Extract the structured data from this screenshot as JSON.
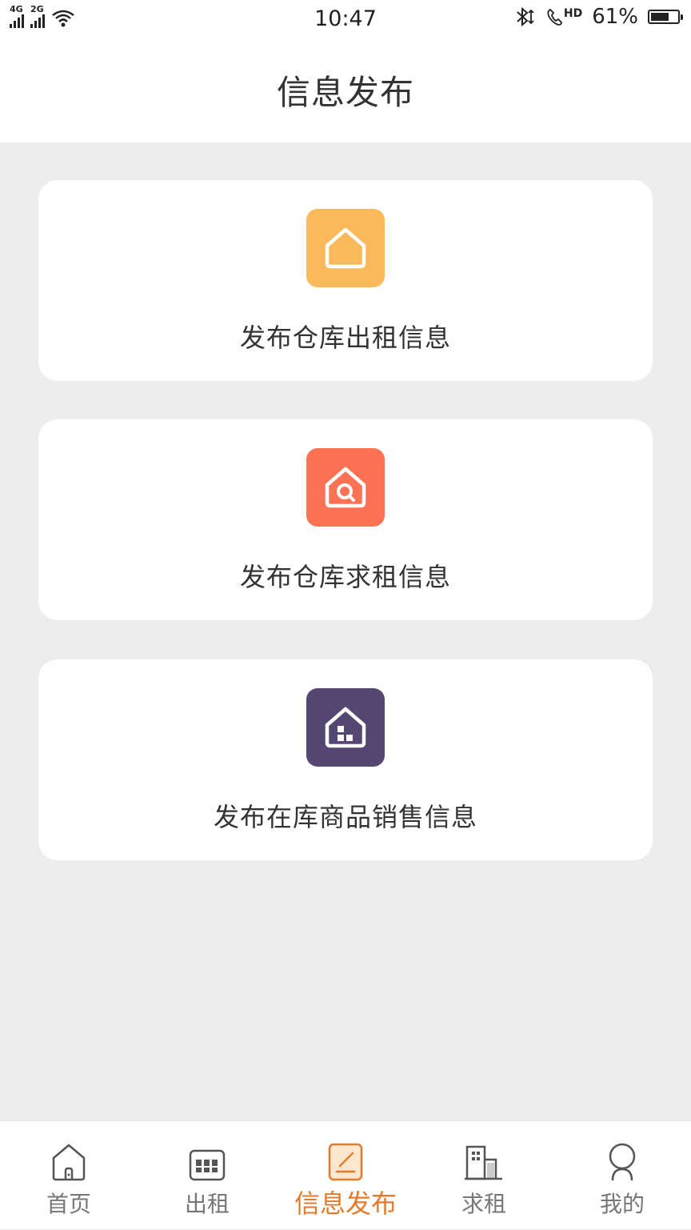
{
  "status_bar": {
    "network_1": "4G",
    "network_2": "2G",
    "time": "10:47",
    "hd": "HD",
    "battery": "61%"
  },
  "header": {
    "title": "信息发布"
  },
  "cards": [
    {
      "label": "发布仓库出租信息",
      "icon": "house-icon",
      "color": "#fcb95b"
    },
    {
      "label": "发布仓库求租信息",
      "icon": "house-search-icon",
      "color": "#fd7255"
    },
    {
      "label": "发布在库商品销售信息",
      "icon": "house-goods-icon",
      "color": "#544772"
    }
  ],
  "tabbar": {
    "items": [
      {
        "label": "首页",
        "icon": "home-icon"
      },
      {
        "label": "出租",
        "icon": "warehouse-icon"
      },
      {
        "label": "信息发布",
        "icon": "publish-icon",
        "active": true
      },
      {
        "label": "求租",
        "icon": "building-icon"
      },
      {
        "label": "我的",
        "icon": "user-icon"
      }
    ],
    "active_color": "#e47b2c"
  }
}
